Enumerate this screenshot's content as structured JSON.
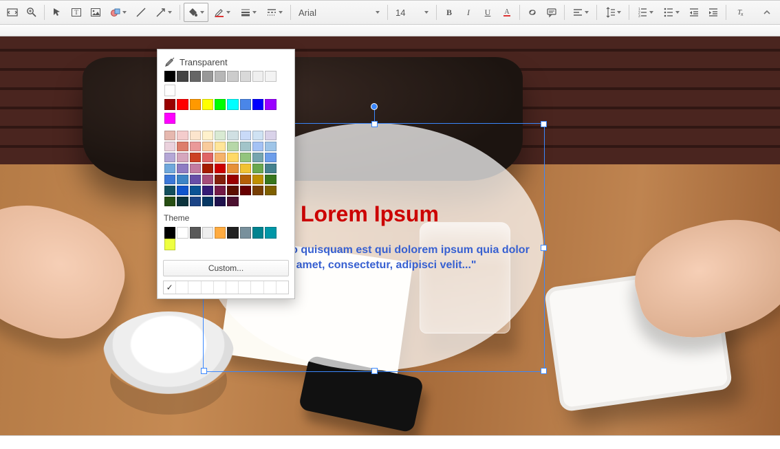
{
  "toolbar": {
    "font_name": "Arial",
    "font_size": "14"
  },
  "shape_text": {
    "title": "Lorem Ipsum",
    "subtitle": "\"Neque porro quisquam est qui dolorem ipsum quia dolor sit amet, consectetur, adipisci velit...\""
  },
  "color_picker": {
    "transparent_label": "Transparent",
    "theme_label": "Theme",
    "custom_label": "Custom...",
    "checkbox_checked": "✓",
    "grayscale": [
      "#000000",
      "#434343",
      "#666666",
      "#999999",
      "#b7b7b7",
      "#cccccc",
      "#d9d9d9",
      "#efefef",
      "#f3f3f3",
      "#ffffff"
    ],
    "standard": [
      "#980000",
      "#ff0000",
      "#ff9900",
      "#ffff00",
      "#00ff00",
      "#00ffff",
      "#4a86e8",
      "#0000ff",
      "#9900ff",
      "#ff00ff"
    ],
    "shades": [
      [
        "#e6b8af",
        "#f4cccc",
        "#fce5cd",
        "#fff2cc",
        "#d9ead3",
        "#d0e0e3",
        "#c9daf8",
        "#cfe2f3",
        "#d9d2e9",
        "#ead1dc"
      ],
      [
        "#dd7e6b",
        "#ea9999",
        "#f9cb9c",
        "#ffe599",
        "#b6d7a8",
        "#a2c4c9",
        "#a4c2f4",
        "#9fc5e8",
        "#b4a7d6",
        "#d5a6bd"
      ],
      [
        "#cc4125",
        "#e06666",
        "#f6b26b",
        "#ffd966",
        "#93c47d",
        "#76a5af",
        "#6d9eeb",
        "#6fa8dc",
        "#8e7cc3",
        "#c27ba0"
      ],
      [
        "#a61c00",
        "#cc0000",
        "#e69138",
        "#f1c232",
        "#6aa84f",
        "#45818e",
        "#3c78d8",
        "#3d85c6",
        "#674ea7",
        "#a64d79"
      ],
      [
        "#85200c",
        "#990000",
        "#b45f06",
        "#bf9000",
        "#38761d",
        "#134f5c",
        "#1155cc",
        "#0b5394",
        "#351c75",
        "#741b47"
      ],
      [
        "#5b0f00",
        "#660000",
        "#783f04",
        "#7f6000",
        "#274e13",
        "#0c343d",
        "#1c4587",
        "#073763",
        "#20124d",
        "#4c1130"
      ]
    ],
    "theme_colors": [
      "#000000",
      "#ffffff",
      "#595959",
      "#eeeeee",
      "#ffab40",
      "#212121",
      "#78909c",
      "#00838f",
      "#0097a7",
      "#eeff41"
    ]
  }
}
